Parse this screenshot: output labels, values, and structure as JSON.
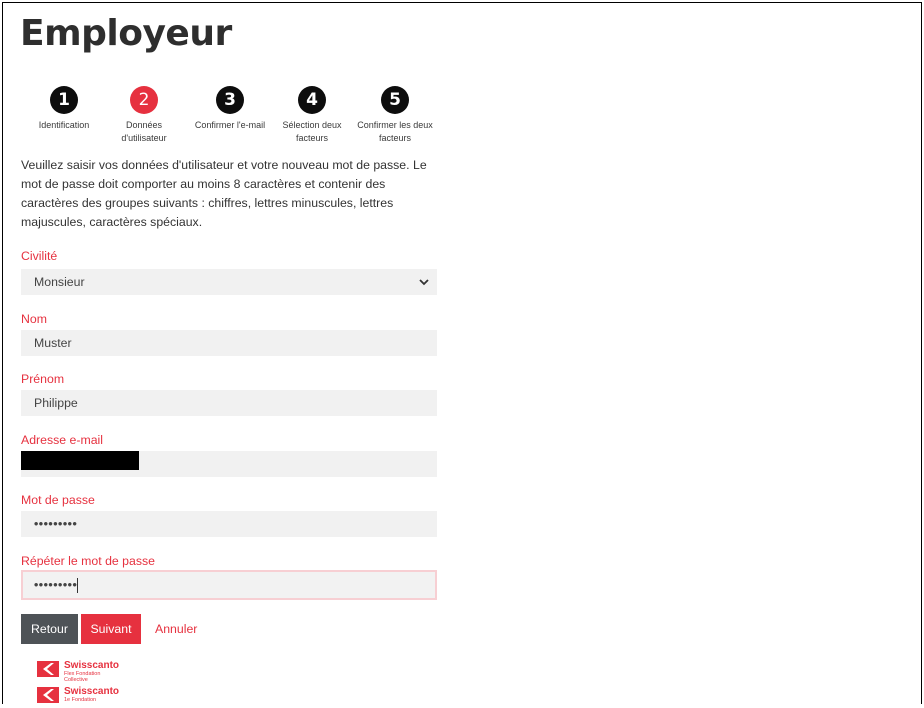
{
  "page": {
    "title": "Employeur"
  },
  "steps": [
    {
      "number": "1",
      "label": "Identification",
      "state": "done"
    },
    {
      "number": "2",
      "label": "Données d'utilisateur",
      "state": "active"
    },
    {
      "number": "3",
      "label": "Confirmer l'e-mail",
      "state": "todo"
    },
    {
      "number": "4",
      "label": "Sélection deux facteurs",
      "state": "todo"
    },
    {
      "number": "5",
      "label": "Confirmer les deux facteurs",
      "state": "todo"
    }
  ],
  "intro": "Veuillez saisir vos données d'utilisateur et votre nouveau mot de passe. Le mot de passe doit comporter au moins 8 caractères et contenir des caractères des groupes suivants : chiffres, lettres minuscules, lettres majuscules, caractères spéciaux.",
  "form": {
    "civilite": {
      "label": "Civilité",
      "value": "Monsieur"
    },
    "nom": {
      "label": "Nom",
      "value": "Muster"
    },
    "prenom": {
      "label": "Prénom",
      "value": "Philippe"
    },
    "email": {
      "label": "Adresse e-mail",
      "value": ""
    },
    "password": {
      "label": "Mot de passe",
      "value": "•••••••••"
    },
    "password_repeat": {
      "label": "Répéter le mot de passe",
      "value": "•••••••••"
    }
  },
  "buttons": {
    "back": "Retour",
    "next": "Suivant",
    "cancel": "Annuler"
  },
  "footer": {
    "logos": [
      {
        "brand": "Swisscanto",
        "sub1": "Flex Fondation",
        "sub2": "Collective"
      },
      {
        "brand": "Swisscanto",
        "sub1": "1e Fondation",
        "sub2": ""
      }
    ]
  },
  "colors": {
    "accent": "#e6313f",
    "dark": "#0d0d0d",
    "button_secondary": "#4e5357",
    "field_bg": "#f1f1f1",
    "focus_border": "#f7cfd3"
  }
}
